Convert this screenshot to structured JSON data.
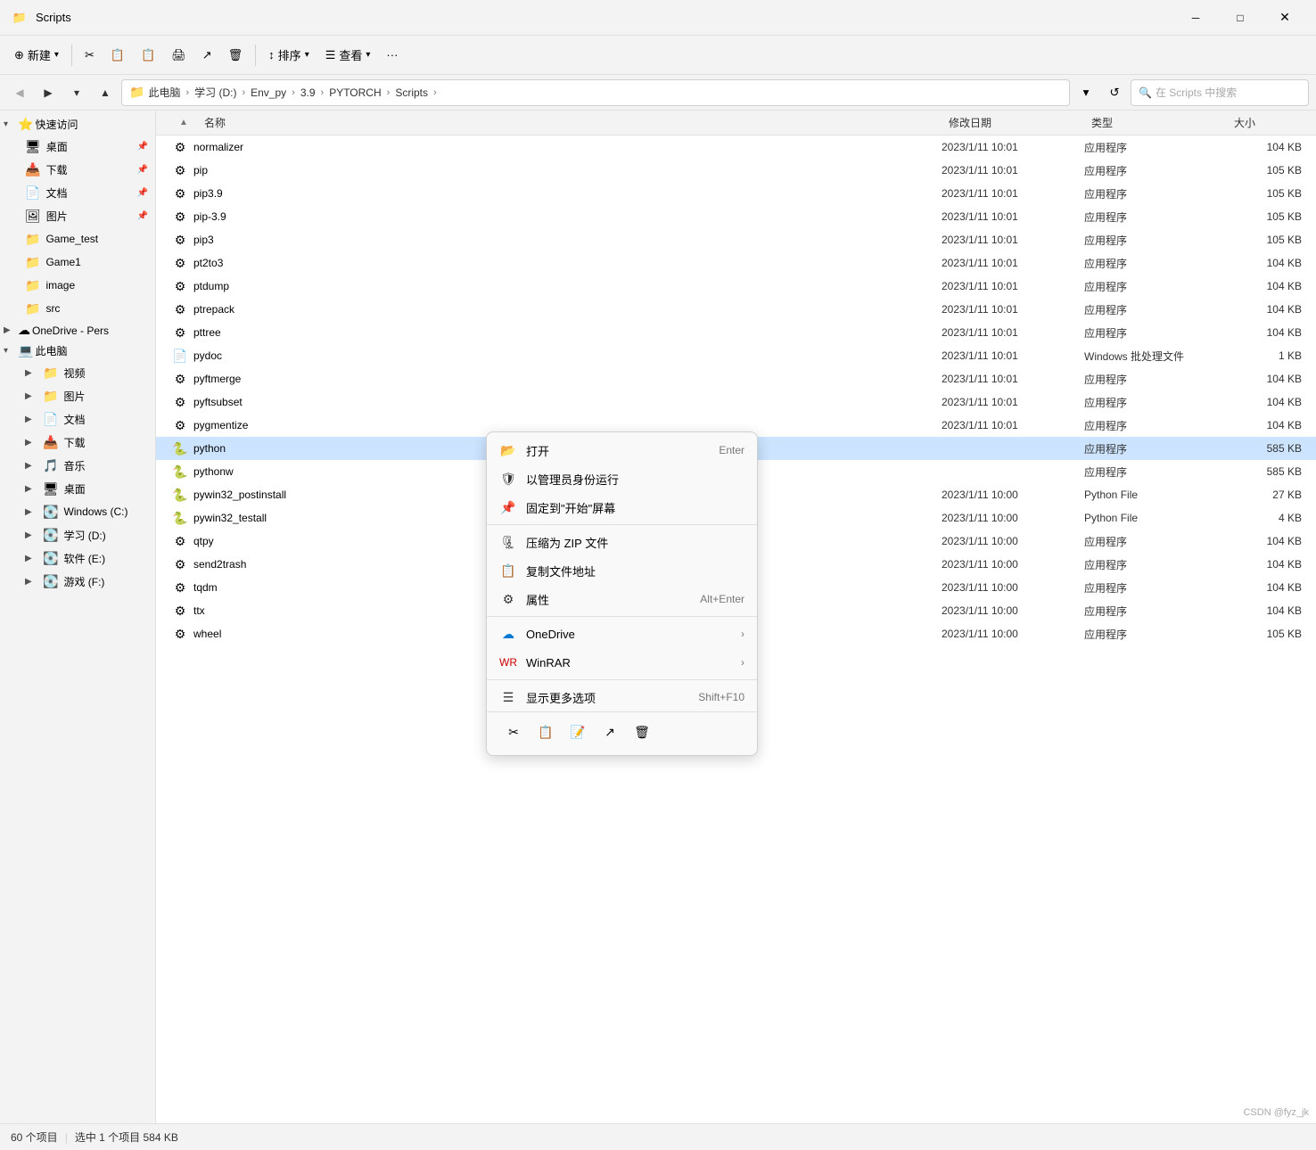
{
  "window": {
    "title": "Scripts",
    "icon": "📁"
  },
  "titlebar": {
    "minimize": "─",
    "maximize": "□"
  },
  "toolbar": {
    "new_label": "新建",
    "cut_icon": "✂",
    "copy_icon": "📋",
    "paste_icon": "📋",
    "stamp_icon": "🖨",
    "share_icon": "↗",
    "delete_icon": "🗑",
    "sort_label": "排序",
    "view_label": "查看",
    "more_icon": "···"
  },
  "addressbar": {
    "path_parts": [
      "此电脑",
      "学习 (D:)",
      "Env_py",
      "3.9",
      "PYTORCH",
      "Scripts"
    ],
    "search_placeholder": "在 Scripts 中搜索"
  },
  "sidebar": {
    "quick_access_label": "快速访问",
    "items": [
      {
        "label": "桌面",
        "icon": "📁",
        "pinned": true
      },
      {
        "label": "下载",
        "icon": "📥",
        "pinned": true
      },
      {
        "label": "文档",
        "icon": "📄",
        "pinned": true
      },
      {
        "label": "图片",
        "icon": "🖼",
        "pinned": true
      },
      {
        "label": "Game_test",
        "icon": "📁",
        "pinned": false
      },
      {
        "label": "Game1",
        "icon": "📁",
        "pinned": false
      },
      {
        "label": "image",
        "icon": "📁",
        "pinned": false
      },
      {
        "label": "src",
        "icon": "📁",
        "pinned": false
      }
    ],
    "onedrive_label": "OneDrive - Pers",
    "this_pc_label": "此电脑",
    "this_pc_children": [
      {
        "label": "视频",
        "icon": "📁"
      },
      {
        "label": "图片",
        "icon": "📁"
      },
      {
        "label": "文档",
        "icon": "📁"
      },
      {
        "label": "下载",
        "icon": "📁"
      },
      {
        "label": "音乐",
        "icon": "🎵"
      },
      {
        "label": "桌面",
        "icon": "📁"
      },
      {
        "label": "Windows (C:)",
        "icon": "💽"
      },
      {
        "label": "学习 (D:)",
        "icon": "💽"
      },
      {
        "label": "软件 (E:)",
        "icon": "💽"
      },
      {
        "label": "游戏 (F:)",
        "icon": "💽"
      }
    ]
  },
  "columns": {
    "name": "名称",
    "date": "修改日期",
    "type": "类型",
    "size": "大小"
  },
  "files": [
    {
      "name": "normalizer",
      "date": "2023/1/11 10:01",
      "type": "应用程序",
      "size": "104 KB",
      "icon": "⚙"
    },
    {
      "name": "pip",
      "date": "2023/1/11 10:01",
      "type": "应用程序",
      "size": "105 KB",
      "icon": "⚙"
    },
    {
      "name": "pip3.9",
      "date": "2023/1/11 10:01",
      "type": "应用程序",
      "size": "105 KB",
      "icon": "⚙"
    },
    {
      "name": "pip-3.9",
      "date": "2023/1/11 10:01",
      "type": "应用程序",
      "size": "105 KB",
      "icon": "⚙"
    },
    {
      "name": "pip3",
      "date": "2023/1/11 10:01",
      "type": "应用程序",
      "size": "105 KB",
      "icon": "⚙"
    },
    {
      "name": "pt2to3",
      "date": "2023/1/11 10:01",
      "type": "应用程序",
      "size": "104 KB",
      "icon": "⚙"
    },
    {
      "name": "ptdump",
      "date": "2023/1/11 10:01",
      "type": "应用程序",
      "size": "104 KB",
      "icon": "⚙"
    },
    {
      "name": "ptrepack",
      "date": "2023/1/11 10:01",
      "type": "应用程序",
      "size": "104 KB",
      "icon": "⚙"
    },
    {
      "name": "pttree",
      "date": "2023/1/11 10:01",
      "type": "应用程序",
      "size": "104 KB",
      "icon": "⚙"
    },
    {
      "name": "pydoc",
      "date": "2023/1/11 10:01",
      "type": "Windows 批处理文件",
      "size": "1 KB",
      "icon": "📄"
    },
    {
      "name": "pyftmerge",
      "date": "2023/1/11 10:01",
      "type": "应用程序",
      "size": "104 KB",
      "icon": "⚙"
    },
    {
      "name": "pyftsubset",
      "date": "2023/1/11 10:01",
      "type": "应用程序",
      "size": "104 KB",
      "icon": "⚙"
    },
    {
      "name": "pygmentize",
      "date": "2023/1/11 10:01",
      "type": "应用程序",
      "size": "104 KB",
      "icon": "⚙"
    },
    {
      "name": "python",
      "date": "",
      "type": "应用程序",
      "size": "585 KB",
      "icon": "🐍",
      "selected": true
    },
    {
      "name": "pythonw",
      "date": "",
      "type": "应用程序",
      "size": "585 KB",
      "icon": "🐍"
    },
    {
      "name": "pywin32_postinstall",
      "date": "2023/1/11 10:00",
      "type": "Python File",
      "size": "27 KB",
      "icon": "🐍"
    },
    {
      "name": "pywin32_testall",
      "date": "2023/1/11 10:00",
      "type": "Python File",
      "size": "4 KB",
      "icon": "🐍"
    },
    {
      "name": "qtpy",
      "date": "2023/1/11 10:00",
      "type": "应用程序",
      "size": "104 KB",
      "icon": "⚙"
    },
    {
      "name": "send2trash",
      "date": "2023/1/11 10:00",
      "type": "应用程序",
      "size": "104 KB",
      "icon": "⚙"
    },
    {
      "name": "tqdm",
      "date": "2023/1/11 10:00",
      "type": "应用程序",
      "size": "104 KB",
      "icon": "⚙"
    },
    {
      "name": "ttx",
      "date": "2023/1/11 10:00",
      "type": "应用程序",
      "size": "104 KB",
      "icon": "⚙"
    },
    {
      "name": "wheel",
      "date": "2023/1/11 10:00",
      "type": "应用程序",
      "size": "105 KB",
      "icon": "⚙"
    }
  ],
  "context_menu": {
    "open_label": "打开",
    "open_shortcut": "Enter",
    "run_as_admin_label": "以管理员身份运行",
    "pin_label": "固定到\"开始\"屏幕",
    "compress_label": "压缩为 ZIP 文件",
    "copy_path_label": "复制文件地址",
    "properties_label": "属性",
    "properties_shortcut": "Alt+Enter",
    "onedrive_label": "OneDrive",
    "winrar_label": "WinRAR",
    "more_options_label": "显示更多选项",
    "more_options_shortcut": "Shift+F10",
    "cut_icon": "✂",
    "copy_icon": "📋",
    "rename_icon": "📝",
    "share_icon": "↗",
    "delete_icon": "🗑"
  },
  "statusbar": {
    "total": "60 个项目",
    "selected": "选中 1 个项目  584 KB"
  },
  "watermark": "CSDN @fyz_jk"
}
